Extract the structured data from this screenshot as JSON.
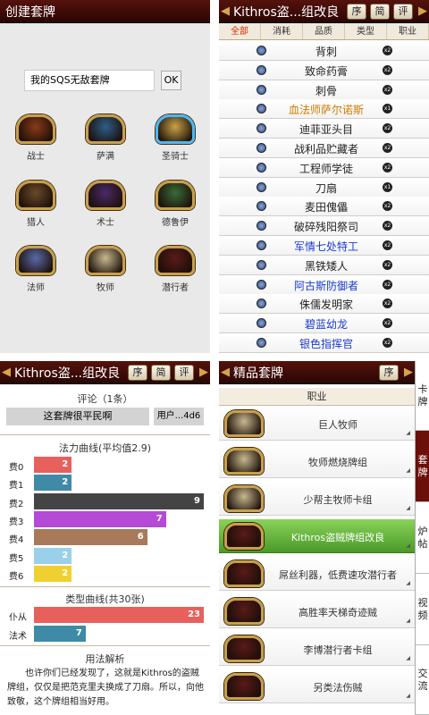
{
  "q1": {
    "title": "创建套牌",
    "deck_name_value": "我的SQS无敌套牌",
    "ok_label": "OK",
    "heroes": [
      {
        "name": "战士",
        "selected": false,
        "color": "#8a3a1a"
      },
      {
        "name": "萨满",
        "selected": false,
        "color": "#2e5d8a"
      },
      {
        "name": "圣骑士",
        "selected": true,
        "color": "#c9a24a"
      },
      {
        "name": "猎人",
        "selected": false,
        "color": "#6a4a2a"
      },
      {
        "name": "术士",
        "selected": false,
        "color": "#4a2a6a"
      },
      {
        "name": "德鲁伊",
        "selected": false,
        "color": "#3a6a3a"
      },
      {
        "name": "法师",
        "selected": false,
        "color": "#5a6aa8"
      },
      {
        "name": "牧师",
        "selected": false,
        "color": "#c8b890"
      },
      {
        "name": "潜行者",
        "selected": false,
        "color": "#5a1a1a"
      }
    ]
  },
  "q2": {
    "title": "Kithros盗...组改良",
    "btn_order": "序",
    "btn_simple": "简",
    "btn_comment": "评",
    "tabs": [
      "全部",
      "消耗",
      "品质",
      "类型",
      "职业"
    ],
    "cards": [
      {
        "name": "背刺",
        "count": "x2",
        "color": "#222222"
      },
      {
        "name": "致命药膏",
        "count": "x2",
        "color": "#222222"
      },
      {
        "name": "刺骨",
        "count": "x2",
        "color": "#222222"
      },
      {
        "name": "血法师萨尔诺斯",
        "count": "x1",
        "color": "#d07a00"
      },
      {
        "name": "迪菲亚头目",
        "count": "x2",
        "color": "#222222"
      },
      {
        "name": "战利品贮藏者",
        "count": "x2",
        "color": "#222222"
      },
      {
        "name": "工程师学徒",
        "count": "x2",
        "color": "#222222"
      },
      {
        "name": "刀扇",
        "count": "x1",
        "color": "#222222"
      },
      {
        "name": "麦田傀儡",
        "count": "x2",
        "color": "#222222"
      },
      {
        "name": "破碎残阳祭司",
        "count": "x2",
        "color": "#222222"
      },
      {
        "name": "军情七处特工",
        "count": "x2",
        "color": "#1a3ad0"
      },
      {
        "name": "黑铁矮人",
        "count": "x2",
        "color": "#222222"
      },
      {
        "name": "阿古斯防御者",
        "count": "x2",
        "color": "#1a3ad0"
      },
      {
        "name": "侏儒发明家",
        "count": "x2",
        "color": "#222222"
      },
      {
        "name": "碧蓝幼龙",
        "count": "x2",
        "color": "#1a3ad0"
      },
      {
        "name": "银色指挥官",
        "count": "x2",
        "color": "#1a3ad0"
      }
    ]
  },
  "q3": {
    "title": "Kithros盗...组改良",
    "btn_order": "序",
    "btn_simple": "简",
    "btn_comment": "评",
    "comments_header": "评论（1条）",
    "comment_text": "这套牌很平民啊",
    "comment_user": "用户...4d6",
    "mana_header": "法力曲线(平均值2.9)",
    "mana_curve": [
      {
        "label": "费0",
        "value": 2,
        "color": "#e8605c"
      },
      {
        "label": "费1",
        "value": 2,
        "color": "#3f8aa6"
      },
      {
        "label": "费2",
        "value": 9,
        "color": "#444444"
      },
      {
        "label": "费3",
        "value": 7,
        "color": "#b44ad6"
      },
      {
        "label": "费4",
        "value": 6,
        "color": "#a87a5a"
      },
      {
        "label": "费5",
        "value": 2,
        "color": "#9ad0ea"
      },
      {
        "label": "费6",
        "value": 2,
        "color": "#f0d030"
      }
    ],
    "type_header": "类型曲线(共30张)",
    "type_curve": [
      {
        "label": "仆从",
        "value": 23,
        "color": "#e8605c"
      },
      {
        "label": "法术",
        "value": 7,
        "color": "#3f8aa6"
      }
    ],
    "analysis_header": "用法解析",
    "analysis_text": "也许你们已经发现了，这就是Kithros的盗贼牌组，仅仅是把范克里夫换成了刀扇。所以，向他致敬，这个牌组相当好用。"
  },
  "q4": {
    "title": "精品套牌",
    "btn_order": "序",
    "filter_label": "职业",
    "decks": [
      {
        "name": "巨人牧师",
        "active": false,
        "color": "#c8b890"
      },
      {
        "name": "牧师燃烧牌组",
        "active": false,
        "color": "#c8b890"
      },
      {
        "name": "少帮主牧师卡组",
        "active": false,
        "color": "#c8b890"
      },
      {
        "name": "Kithros盗贼牌组改良",
        "active": true,
        "color": "#5a1a1a"
      },
      {
        "name": "屌丝利器，低费速攻潜行者",
        "active": false,
        "color": "#5a1a1a"
      },
      {
        "name": "高胜率天梯奇迹贼",
        "active": false,
        "color": "#5a1a1a"
      },
      {
        "name": "李博潜行者卡组",
        "active": false,
        "color": "#5a1a1a"
      },
      {
        "name": "另类法伤贼",
        "active": false,
        "color": "#5a1a1a"
      }
    ],
    "side_tabs": [
      {
        "label": "卡牌",
        "active": false
      },
      {
        "label": "套牌",
        "active": true
      },
      {
        "label": "炉帖",
        "active": false
      },
      {
        "label": "视频",
        "active": false
      },
      {
        "label": "交流",
        "active": false
      }
    ]
  }
}
